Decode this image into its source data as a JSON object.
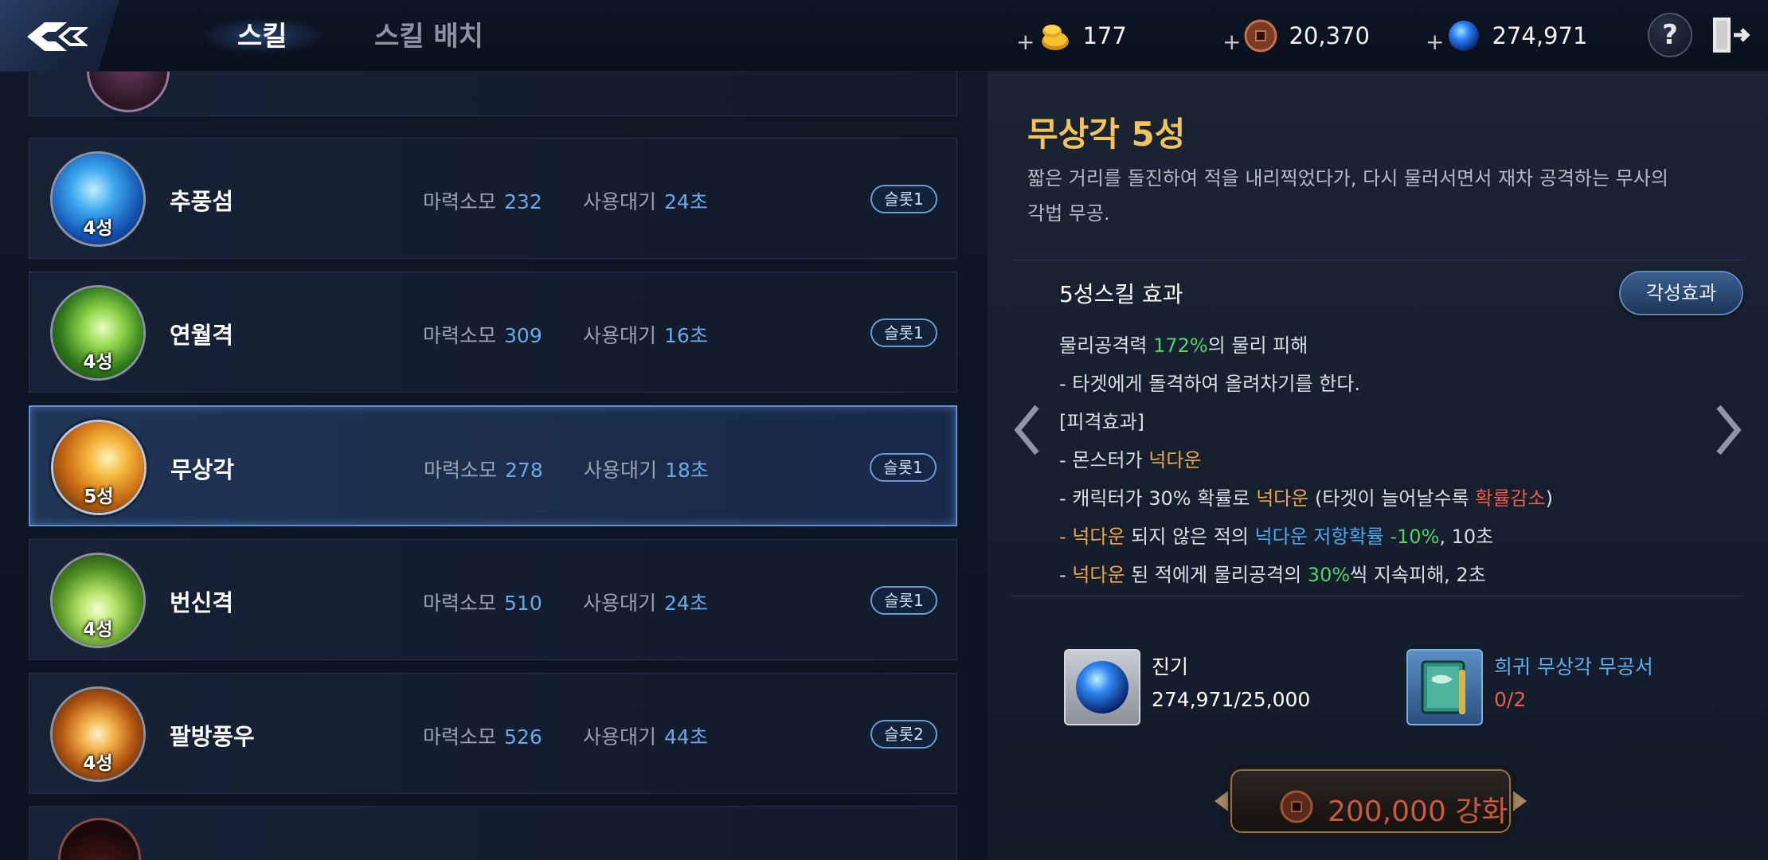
{
  "tabs": {
    "skill": "스킬",
    "placement": "스킬 배치"
  },
  "currencies": {
    "gold": {
      "plus": "+",
      "value": "177"
    },
    "coin": {
      "plus": "+",
      "value": "20,370"
    },
    "orb": {
      "plus": "+",
      "value": "274,971"
    }
  },
  "help_label": "?",
  "skills": [
    {
      "name": "추풍섬",
      "stars": "4성",
      "mp_label": "마력소모",
      "mp": "232",
      "cd_label": "사용대기",
      "cd": "24초",
      "slot": "슬롯1"
    },
    {
      "name": "연월격",
      "stars": "4성",
      "mp_label": "마력소모",
      "mp": "309",
      "cd_label": "사용대기",
      "cd": "16초",
      "slot": "슬롯1"
    },
    {
      "name": "무상각",
      "stars": "5성",
      "mp_label": "마력소모",
      "mp": "278",
      "cd_label": "사용대기",
      "cd": "18초",
      "slot": "슬롯1"
    },
    {
      "name": "번신격",
      "stars": "4성",
      "mp_label": "마력소모",
      "mp": "510",
      "cd_label": "사용대기",
      "cd": "24초",
      "slot": "슬롯1"
    },
    {
      "name": "팔방풍우",
      "stars": "4성",
      "mp_label": "마력소모",
      "mp": "526",
      "cd_label": "사용대기",
      "cd": "44초",
      "slot": "슬롯2"
    }
  ],
  "detail": {
    "title": "무상각 5성",
    "desc_line1": "짧은 거리를 돌진하여 적을 내리찍었다가, 다시 물러서면서 재차 공격하는 무사의",
    "desc_line2": "각법 무공.",
    "effect_title": "5성스킬 효과",
    "awaken_button": "각성효과",
    "lines": {
      "l1_a": "물리공격력 ",
      "l1_b": "172%",
      "l1_c": "의 물리 피해",
      "l2": " - 타겟에게 돌격하여 올려차기를 한다.",
      "l3": "[피격효과]",
      "l4_a": " - 몬스터가 ",
      "l4_b": "넉다운",
      "l5_a": " - 캐릭터가 30% 확률로 ",
      "l5_b": "넉다운",
      "l5_c": " (타겟이 늘어날수록 ",
      "l5_d": "확률감소",
      "l5_e": ")",
      "l6_a": " - ",
      "l6_b": "넉다운",
      "l6_c": " 되지 않은 적의 ",
      "l6_d": "넉다운 저항확률",
      "l6_e": " -10%",
      "l6_f": ", 10초",
      "l7_a": " - ",
      "l7_b": "넉다운",
      "l7_c": " 된 적에게 물리공격의 ",
      "l7_d": "30%",
      "l7_e": "씩 지속피해, 2초"
    },
    "materials": [
      {
        "name": "진기",
        "value": "274,971/25,000",
        "icon": "blue-orb-icon"
      },
      {
        "name": "희귀 무상각 무공서",
        "value": "0/2",
        "icon": "skill-book-icon"
      }
    ],
    "upgrade_button": "200,000 강화"
  },
  "colors": {
    "title_gold": "#f2c35a",
    "highlight_green": "#4fd36a",
    "highlight_orange": "#f0a44a",
    "highlight_blue": "#4aa8ec",
    "highlight_red": "#ee5a4a",
    "selected_border": "#5d8fd6"
  }
}
